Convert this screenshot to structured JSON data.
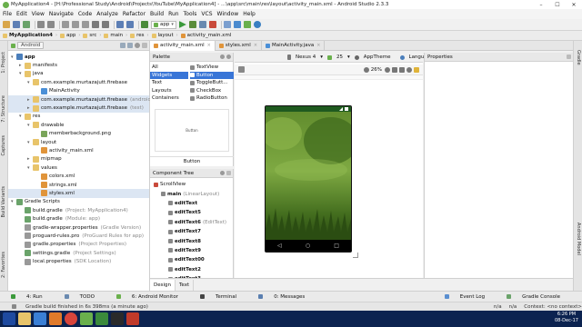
{
  "window": {
    "title": "MyApplication4 - [H:\\Professional Study\\Android\\Projects\\YouTube\\MyApplication4] - ...\\app\\src\\main\\res\\layout\\activity_main.xml - Android Studio 2.3.3"
  },
  "menu": [
    "File",
    "Edit",
    "View",
    "Navigate",
    "Code",
    "Analyze",
    "Refactor",
    "Build",
    "Run",
    "Tools",
    "VCS",
    "Window",
    "Help"
  ],
  "breadcrumbs": [
    "MyApplication4",
    "app",
    "src",
    "main",
    "res",
    "layout",
    "activity_main.xml"
  ],
  "left_tabs": [
    "1: Project",
    "7: Structure",
    "Captures",
    "Build Variants",
    "2: Favorites"
  ],
  "right_tabs": [
    "Gradle",
    "Android Model"
  ],
  "project_panel": {
    "view_selector": "Android",
    "tree": [
      {
        "label": "app",
        "level": 0,
        "caret": "▾",
        "bold": true,
        "icon": "module-icon",
        "color": "#4a7ebb"
      },
      {
        "label": "manifests",
        "level": 1,
        "caret": "▸",
        "icon": "folder-icon",
        "color": "#e8c46a"
      },
      {
        "label": "java",
        "level": 1,
        "caret": "▾",
        "icon": "folder-icon",
        "color": "#e8c46a"
      },
      {
        "label": "com.example.murtazajutt.firebase",
        "level": 2,
        "caret": "▾",
        "icon": "package-icon",
        "color": "#e8c46a"
      },
      {
        "label": "MainActivity",
        "level": 3,
        "caret": "",
        "icon": "class-icon",
        "color": "#4a8fd7"
      },
      {
        "label": "com.example.murtazajutt.firebase",
        "level": 2,
        "caret": "▸",
        "icon": "package-icon",
        "color": "#e8c46a",
        "gray": "(androidTest)",
        "hl": true
      },
      {
        "label": "com.example.murtazajutt.firebase",
        "level": 2,
        "caret": "▸",
        "icon": "package-icon",
        "color": "#e8c46a",
        "gray": "(test)",
        "hl": true
      },
      {
        "label": "res",
        "level": 1,
        "caret": "▾",
        "icon": "folder-icon",
        "color": "#e8c46a"
      },
      {
        "label": "drawable",
        "level": 2,
        "caret": "▾",
        "icon": "folder-icon",
        "color": "#e8c46a"
      },
      {
        "label": "memberbackground.png",
        "level": 3,
        "caret": "",
        "icon": "image-icon",
        "color": "#7aa55a"
      },
      {
        "label": "layout",
        "level": 2,
        "caret": "▾",
        "icon": "folder-icon",
        "color": "#e8c46a"
      },
      {
        "label": "activity_main.xml",
        "level": 3,
        "caret": "",
        "icon": "xml-icon",
        "color": "#e0943a"
      },
      {
        "label": "mipmap",
        "level": 2,
        "caret": "▸",
        "icon": "folder-icon",
        "color": "#e8c46a"
      },
      {
        "label": "values",
        "level": 2,
        "caret": "▾",
        "icon": "folder-icon",
        "color": "#e8c46a"
      },
      {
        "label": "colors.xml",
        "level": 3,
        "caret": "",
        "icon": "xml-icon",
        "color": "#e0943a"
      },
      {
        "label": "strings.xml",
        "level": 3,
        "caret": "",
        "icon": "xml-icon",
        "color": "#e0943a"
      },
      {
        "label": "styles.xml",
        "level": 3,
        "caret": "",
        "icon": "xml-icon",
        "color": "#e0943a",
        "hl": true
      },
      {
        "label": "Gradle Scripts",
        "level": 0,
        "caret": "▾",
        "icon": "gradle-icon",
        "color": "#6aa36a"
      },
      {
        "label": "build.gradle",
        "level": 1,
        "caret": "",
        "icon": "gradle-icon",
        "color": "#6aa36a",
        "gray": "(Project: MyApplication4)"
      },
      {
        "label": "build.gradle",
        "level": 1,
        "caret": "",
        "icon": "gradle-icon",
        "color": "#6aa36a",
        "gray": "(Module: app)"
      },
      {
        "label": "gradle-wrapper.properties",
        "level": 1,
        "caret": "",
        "icon": "properties-icon",
        "color": "#999999",
        "gray": "(Gradle Version)"
      },
      {
        "label": "proguard-rules.pro",
        "level": 1,
        "caret": "",
        "icon": "file-icon",
        "color": "#999999",
        "gray": "(ProGuard Rules for app)"
      },
      {
        "label": "gradle.properties",
        "level": 1,
        "caret": "",
        "icon": "properties-icon",
        "color": "#999999",
        "gray": "(Project Properties)"
      },
      {
        "label": "settings.gradle",
        "level": 1,
        "caret": "",
        "icon": "gradle-icon",
        "color": "#6aa36a",
        "gray": "(Project Settings)"
      },
      {
        "label": "local.properties",
        "level": 1,
        "caret": "",
        "icon": "properties-icon",
        "color": "#999999",
        "gray": "(SDK Location)"
      }
    ]
  },
  "editor_tabs": [
    {
      "label": "activity_main.xml",
      "active": true,
      "icon": "xml-icon",
      "color": "#e0943a"
    },
    {
      "label": "styles.xml",
      "active": false,
      "icon": "xml-icon",
      "color": "#e0943a"
    },
    {
      "label": "MainActivity.java",
      "active": false,
      "icon": "class-icon",
      "color": "#4a8fd7"
    }
  ],
  "palette": {
    "title": "Palette",
    "categories": [
      "All",
      "Widgets",
      "Text",
      "Layouts",
      "Containers"
    ],
    "selected_category": 1,
    "items": [
      "TextView",
      "Button",
      "ToggleButt...",
      "CheckBox",
      "RadioButton"
    ],
    "selected_item": 1,
    "preview_text": "Button",
    "preview_label": "Button"
  },
  "component_tree": {
    "title": "Component Tree",
    "items": [
      {
        "label": "ScrollView",
        "level": 0,
        "bold": false
      },
      {
        "label": "main",
        "gray": "(LinearLayout)",
        "level": 1,
        "bold": true
      },
      {
        "label": "editText",
        "level": 2,
        "bold": true
      },
      {
        "label": "editText5",
        "level": 2,
        "bold": true
      },
      {
        "label": "editText6",
        "gray": "(EditText)",
        "level": 2,
        "bold": true
      },
      {
        "label": "editText7",
        "level": 2,
        "bold": true
      },
      {
        "label": "editText8",
        "level": 2,
        "bold": true
      },
      {
        "label": "editText9",
        "level": 2,
        "bold": true
      },
      {
        "label": "editText00",
        "level": 2,
        "bold": true
      },
      {
        "label": "editText2",
        "level": 2,
        "bold": true
      },
      {
        "label": "editText3",
        "level": 2,
        "bold": true
      }
    ]
  },
  "canvas_toolbar": {
    "device": "Nexus 4",
    "api": "25",
    "theme": "AppTheme",
    "language": "Language",
    "zoom": "26%"
  },
  "properties": {
    "title": "Properties"
  },
  "design_tabs": [
    "Design",
    "Text"
  ],
  "bottom_tools": [
    "4: Run",
    "TODO",
    "6: Android Monitor",
    "Terminal",
    "0: Messages"
  ],
  "bottom_right_tools": [
    "Event Log",
    "Gradle Console"
  ],
  "status": {
    "message": "Gradle build finished in 6s 398ms (a minute ago)",
    "right": [
      "n/a",
      "n/a",
      "Context: <no context>"
    ]
  },
  "taskbar": {
    "time": "6:26 PM",
    "date": "08-Dec-17"
  },
  "colors": {
    "selection": "#3875d7",
    "taskbar": "#0c2350",
    "accent_green": "#3b8a3b"
  }
}
